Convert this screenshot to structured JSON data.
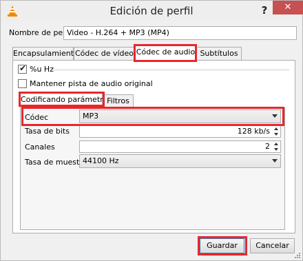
{
  "window": {
    "title": "Edición de perfil",
    "help_label": "?",
    "close_label": "✕",
    "app_icon": "vlc-cone-icon"
  },
  "profile": {
    "name_label": "Nombre de perfil",
    "name_value": "Video - H.264 + MP3 (MP4)"
  },
  "tabs": [
    {
      "label": "Encapsulamiento",
      "selected": false
    },
    {
      "label": "Códec de vídeo",
      "selected": false
    },
    {
      "label": "Códec de audio",
      "selected": true
    },
    {
      "label": "Subtítulos",
      "selected": false
    }
  ],
  "audio": {
    "audio_checkbox_label": "%u Hz",
    "audio_checked": true,
    "keep_original_label": "Mantener pista de audio original",
    "keep_original_checked": false
  },
  "subtabs": [
    {
      "label": "Codificando parámetros",
      "selected": true
    },
    {
      "label": "Filtros",
      "selected": false
    }
  ],
  "params": {
    "codec_label": "Códec",
    "codec_value": "MP3",
    "bitrate_label": "Tasa de bits",
    "bitrate_value": "128 kb/s",
    "channels_label": "Canales",
    "channels_value": "2",
    "samplerate_label": "Tasa de muestreo",
    "samplerate_value": "44100 Hz"
  },
  "buttons": {
    "save": "Guardar",
    "cancel": "Cancelar"
  },
  "colors": {
    "highlight": "#e8262a",
    "close_button": "#c75050"
  }
}
